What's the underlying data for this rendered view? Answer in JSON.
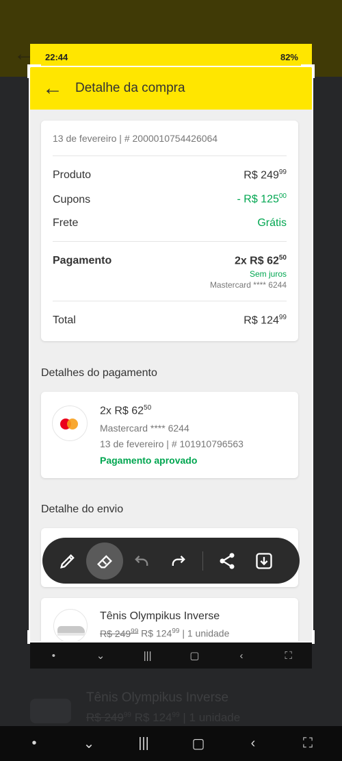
{
  "status": {
    "time": "22:44",
    "battery": "82%"
  },
  "header": {
    "title": "Detalhe da compra"
  },
  "summary": {
    "date": "13 de fevereiro",
    "order": "# 2000010754426064",
    "product_label": "Produto",
    "product_value": "R$ 249",
    "product_cents": "99",
    "coupons_label": "Cupons",
    "coupons_value": "- R$ 125",
    "coupons_cents": "00",
    "shipping_label": "Frete",
    "shipping_value": "Grátis",
    "payment_label": "Pagamento",
    "payment_value": "2x R$ 62",
    "payment_cents": "50",
    "installment_note": "Sem juros",
    "card": "Mastercard **** 6244",
    "total_label": "Total",
    "total_value": "R$ 124",
    "total_cents": "99"
  },
  "payment_details": {
    "title": "Detalhes do pagamento",
    "amount": "2x R$ 62",
    "amount_cents": "50",
    "card": "Mastercard **** 6244",
    "date": "13 de fevereiro",
    "transaction": "# 101910796563",
    "status": "Pagamento aprovado"
  },
  "shipping": {
    "title": "Detalhe do envio"
  },
  "product": {
    "name": "Tênis Olympikus Inverse",
    "old_price": "R$ 249",
    "old_cents": "99",
    "new_price": "R$ 124",
    "new_cents": "99",
    "qty": "| 1 unidade"
  },
  "toolbar": {
    "tools": [
      "pen-icon",
      "eraser-icon",
      "undo-icon",
      "redo-icon",
      "share-icon",
      "save-icon"
    ]
  },
  "colors": {
    "brand_yellow": "#ffe600",
    "green": "#00a650"
  }
}
